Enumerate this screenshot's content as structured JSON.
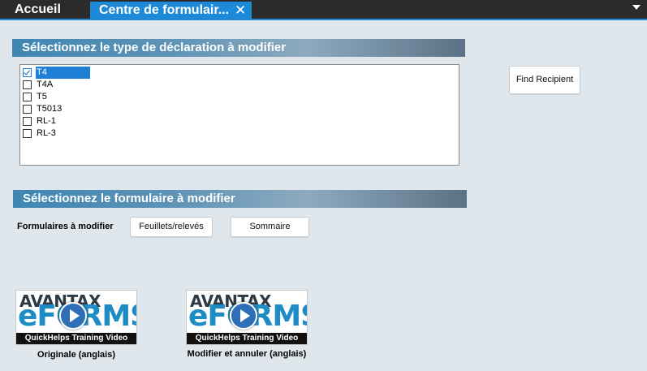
{
  "tabs": {
    "home": "Accueil",
    "active": "Centre de formulair...",
    "close_glyph": "✕"
  },
  "section1": {
    "title": "Sélectionnez le type de déclaration à modifier",
    "items": [
      {
        "label": "T4",
        "checked": true,
        "selected": true
      },
      {
        "label": "T4A",
        "checked": false,
        "selected": false
      },
      {
        "label": "T5",
        "checked": false,
        "selected": false
      },
      {
        "label": "T5013",
        "checked": false,
        "selected": false
      },
      {
        "label": "RL-1",
        "checked": false,
        "selected": false
      },
      {
        "label": "RL-3",
        "checked": false,
        "selected": false
      }
    ]
  },
  "find_recipient": "Find Recipient",
  "section2": {
    "title": "Sélectionnez le formulaire à modifier",
    "forms_label": "Formulaires à modifier",
    "btn_slips": "Feuillets/relevés",
    "btn_summary": "Sommaire"
  },
  "videos": [
    {
      "brand": "AVANTAX",
      "product": "eFORMS",
      "caption": "QuickHelps Training Video",
      "label": "Originale (anglais)"
    },
    {
      "brand": "AVANTAX",
      "product": "eFORMS",
      "caption": "QuickHelps Training Video",
      "label": "Modifier et annuler (anglais)"
    }
  ],
  "colors": {
    "tab_active": "#1c8ad8",
    "tab_bar": "#2b2b2b",
    "background": "#dfe7ec",
    "selection": "#1f7fd6"
  }
}
